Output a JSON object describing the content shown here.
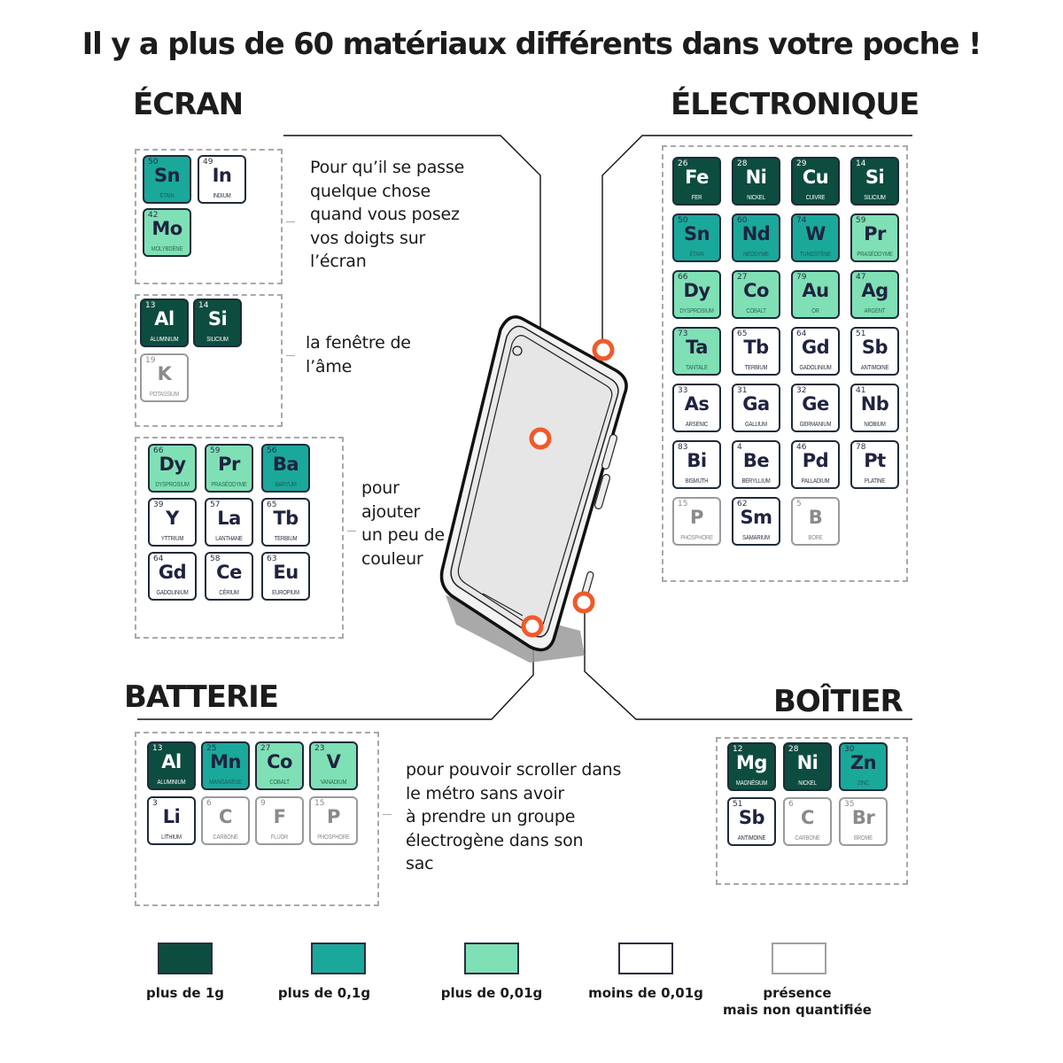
{
  "title": "Il y a plus de 60 matériaux différents dans votre poche !",
  "colors": {
    "plus_de_1g": "#0d4d3f",
    "plus_de_0_1g": "#1aa89b",
    "plus_de_0_01g": "#7fe0b5",
    "moins_de_0_01g": "#ffffff",
    "presence_non_quantifiee": "#ffffff",
    "marker": "#f05a2a"
  },
  "sections": {
    "ecran": {
      "title": "ÉCRAN",
      "groups": [
        {
          "description": [
            "Pour qu’il se passe",
            "quelque chose",
            "quand vous posez",
            "vos doigts sur",
            "l’écran"
          ],
          "elements": [
            {
              "num": "50",
              "sym": "Sn",
              "name": "Étain",
              "cat": "c2"
            },
            {
              "num": "49",
              "sym": "In",
              "name": "Indium",
              "cat": "c4"
            },
            {
              "num": "42",
              "sym": "Mo",
              "name": "Molybdène",
              "cat": "c3"
            }
          ]
        },
        {
          "description": [
            "la fenêtre de",
            "l’âme"
          ],
          "elements": [
            {
              "num": "13",
              "sym": "Al",
              "name": "Aluminium",
              "cat": "c1"
            },
            {
              "num": "14",
              "sym": "Si",
              "name": "Silicium",
              "cat": "c1"
            },
            {
              "num": "19",
              "sym": "K",
              "name": "Potassium",
              "cat": "c5"
            }
          ]
        },
        {
          "description": [
            "pour",
            "ajouter",
            "un peu de",
            "couleur"
          ],
          "elements": [
            {
              "num": "66",
              "sym": "Dy",
              "name": "Dysprosium",
              "cat": "c3"
            },
            {
              "num": "59",
              "sym": "Pr",
              "name": "Praséodyme",
              "cat": "c3"
            },
            {
              "num": "56",
              "sym": "Ba",
              "name": "Baryum",
              "cat": "c2"
            },
            {
              "num": "39",
              "sym": "Y",
              "name": "Yttrium",
              "cat": "c4"
            },
            {
              "num": "57",
              "sym": "La",
              "name": "Lanthane",
              "cat": "c4"
            },
            {
              "num": "65",
              "sym": "Tb",
              "name": "Terbium",
              "cat": "c4"
            },
            {
              "num": "64",
              "sym": "Gd",
              "name": "Gadolinium",
              "cat": "c4"
            },
            {
              "num": "58",
              "sym": "Ce",
              "name": "Cérium",
              "cat": "c4"
            },
            {
              "num": "63",
              "sym": "Eu",
              "name": "Europium",
              "cat": "c4"
            }
          ]
        }
      ]
    },
    "electronique": {
      "title": "ÉLECTRONIQUE",
      "elements": [
        {
          "num": "26",
          "sym": "Fe",
          "name": "Fer",
          "cat": "c1"
        },
        {
          "num": "28",
          "sym": "Ni",
          "name": "Nickel",
          "cat": "c1"
        },
        {
          "num": "29",
          "sym": "Cu",
          "name": "Cuivre",
          "cat": "c1"
        },
        {
          "num": "14",
          "sym": "Si",
          "name": "Silicium",
          "cat": "c1"
        },
        {
          "num": "50",
          "sym": "Sn",
          "name": "Étain",
          "cat": "c2"
        },
        {
          "num": "60",
          "sym": "Nd",
          "name": "Néodyme",
          "cat": "c2"
        },
        {
          "num": "74",
          "sym": "W",
          "name": "Tungstène",
          "cat": "c2"
        },
        {
          "num": "59",
          "sym": "Pr",
          "name": "Praséodyme",
          "cat": "c3"
        },
        {
          "num": "66",
          "sym": "Dy",
          "name": "Dysprosium",
          "cat": "c3"
        },
        {
          "num": "27",
          "sym": "Co",
          "name": "Cobalt",
          "cat": "c3"
        },
        {
          "num": "79",
          "sym": "Au",
          "name": "Or",
          "cat": "c3"
        },
        {
          "num": "47",
          "sym": "Ag",
          "name": "Argent",
          "cat": "c3"
        },
        {
          "num": "73",
          "sym": "Ta",
          "name": "Tantale",
          "cat": "c3"
        },
        {
          "num": "65",
          "sym": "Tb",
          "name": "Terbium",
          "cat": "c4"
        },
        {
          "num": "64",
          "sym": "Gd",
          "name": "Gadolinium",
          "cat": "c4"
        },
        {
          "num": "51",
          "sym": "Sb",
          "name": "Antimoine",
          "cat": "c4"
        },
        {
          "num": "33",
          "sym": "As",
          "name": "Arsenic",
          "cat": "c4"
        },
        {
          "num": "31",
          "sym": "Ga",
          "name": "Gallium",
          "cat": "c4"
        },
        {
          "num": "32",
          "sym": "Ge",
          "name": "Germanium",
          "cat": "c4"
        },
        {
          "num": "41",
          "sym": "Nb",
          "name": "Niobium",
          "cat": "c4"
        },
        {
          "num": "83",
          "sym": "Bi",
          "name": "Bismuth",
          "cat": "c4"
        },
        {
          "num": "4",
          "sym": "Be",
          "name": "Beryllium",
          "cat": "c4"
        },
        {
          "num": "46",
          "sym": "Pd",
          "name": "Palladium",
          "cat": "c4"
        },
        {
          "num": "78",
          "sym": "Pt",
          "name": "Platine",
          "cat": "c4"
        },
        {
          "num": "15",
          "sym": "P",
          "name": "Phosphore",
          "cat": "c5"
        },
        {
          "num": "62",
          "sym": "Sm",
          "name": "Samarium",
          "cat": "c4"
        },
        {
          "num": "5",
          "sym": "B",
          "name": "Bore",
          "cat": "c5"
        }
      ]
    },
    "batterie": {
      "title": "BATTERIE",
      "description": [
        "pour pouvoir scroller dans",
        "le métro sans avoir",
        "à prendre un groupe",
        "électrogène dans son",
        "sac"
      ],
      "elements": [
        {
          "num": "13",
          "sym": "Al",
          "name": "Aluminium",
          "cat": "c1"
        },
        {
          "num": "25",
          "sym": "Mn",
          "name": "Manganèse",
          "cat": "c2"
        },
        {
          "num": "27",
          "sym": "Co",
          "name": "Cobalt",
          "cat": "c3"
        },
        {
          "num": "23",
          "sym": "V",
          "name": "Vanadium",
          "cat": "c3"
        },
        {
          "num": "3",
          "sym": "Li",
          "name": "Lithium",
          "cat": "c4"
        },
        {
          "num": "6",
          "sym": "C",
          "name": "Carbone",
          "cat": "c5"
        },
        {
          "num": "9",
          "sym": "F",
          "name": "Fluor",
          "cat": "c5"
        },
        {
          "num": "15",
          "sym": "P",
          "name": "Phosphore",
          "cat": "c5"
        }
      ]
    },
    "boitier": {
      "title": "BOÎTIER",
      "elements": [
        {
          "num": "12",
          "sym": "Mg",
          "name": "Magnésium",
          "cat": "c1"
        },
        {
          "num": "28",
          "sym": "Ni",
          "name": "Nickel",
          "cat": "c1"
        },
        {
          "num": "30",
          "sym": "Zn",
          "name": "Zinc",
          "cat": "c2"
        },
        {
          "num": "51",
          "sym": "Sb",
          "name": "Antimoine",
          "cat": "c4"
        },
        {
          "num": "6",
          "sym": "C",
          "name": "Carbone",
          "cat": "c5"
        },
        {
          "num": "35",
          "sym": "Br",
          "name": "Brome",
          "cat": "c5"
        }
      ]
    }
  },
  "legend": [
    {
      "label": "plus de 1g",
      "cat": "c1"
    },
    {
      "label": "plus de 0,1g",
      "cat": "c2"
    },
    {
      "label": "plus de 0,01g",
      "cat": "c3"
    },
    {
      "label": "moins de 0,01g",
      "cat": "c4"
    },
    {
      "label": "présence\nmais non quantifiée",
      "cat": "c5"
    }
  ]
}
